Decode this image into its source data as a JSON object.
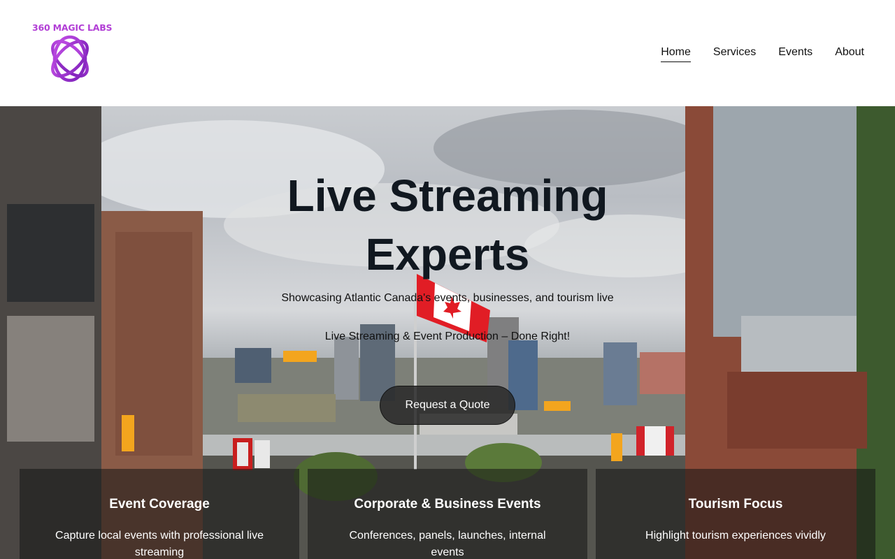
{
  "brand": {
    "logo_text": "360 MAGIC LABS"
  },
  "nav": {
    "items": [
      {
        "label": "Home",
        "active": true
      },
      {
        "label": "Services",
        "active": false
      },
      {
        "label": "Events",
        "active": false
      },
      {
        "label": "About",
        "active": false
      }
    ]
  },
  "hero": {
    "title": "Live Streaming Experts",
    "subtitle": "Showcasing Atlantic Canada's events, businesses, and tourism live",
    "tagline": "Live Streaming & Event Production – Done Right!",
    "cta_label": "Request a Quote"
  },
  "features": [
    {
      "title": "Event Coverage",
      "text": "Capture local events with professional live streaming"
    },
    {
      "title": "Corporate & Business Events",
      "text": "Conferences, panels, launches, internal events"
    },
    {
      "title": "Tourism Focus",
      "text": "Highlight tourism experiences vividly"
    }
  ],
  "colors": {
    "brand_purple": "#a63fd6",
    "nav_text": "#111111",
    "overlay": "#141414"
  }
}
